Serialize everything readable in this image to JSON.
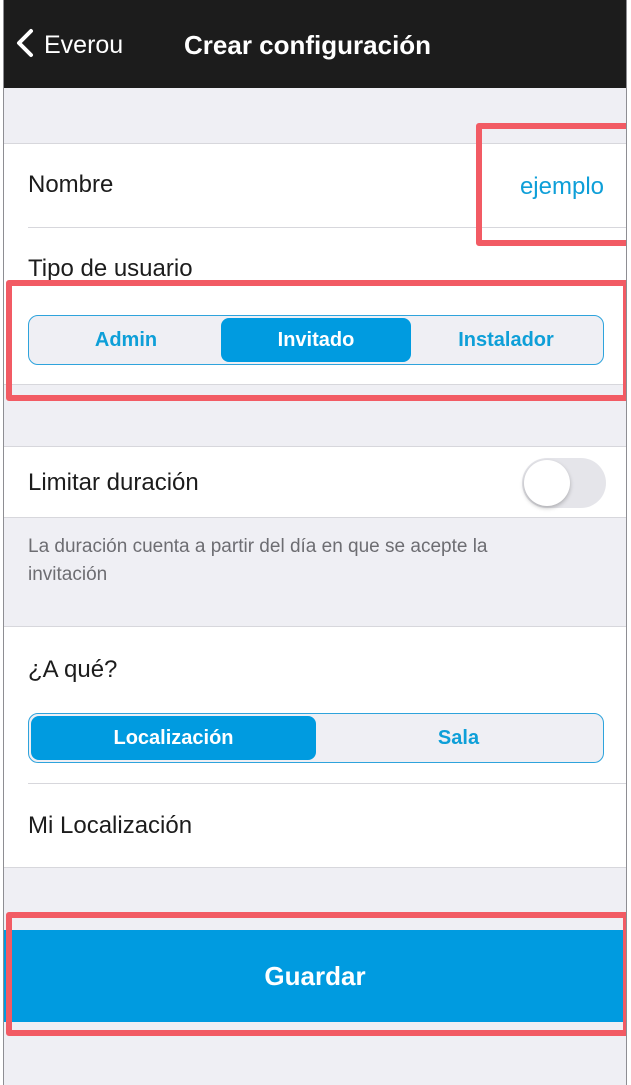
{
  "nav": {
    "back_label": "Everou",
    "title": "Crear configuración"
  },
  "name_row": {
    "label": "Nombre",
    "value": "ejemplo"
  },
  "user_type": {
    "label": "Tipo de usuario",
    "options": [
      "Admin",
      "Invitado",
      "Instalador"
    ],
    "selected": "Invitado"
  },
  "duration": {
    "label": "Limitar duración",
    "toggle_on": false,
    "footnote": "La duración cuenta a partir del día en que se acepte la invitación"
  },
  "target": {
    "label": "¿A qué?",
    "options": [
      "Localización",
      "Sala"
    ],
    "selected": "Localización",
    "location_label": "Mi Localización"
  },
  "save_button": {
    "label": "Guardar"
  },
  "colors": {
    "accent": "#009be0",
    "highlight": "#f25b64",
    "navbar": "#1c1c1c"
  }
}
